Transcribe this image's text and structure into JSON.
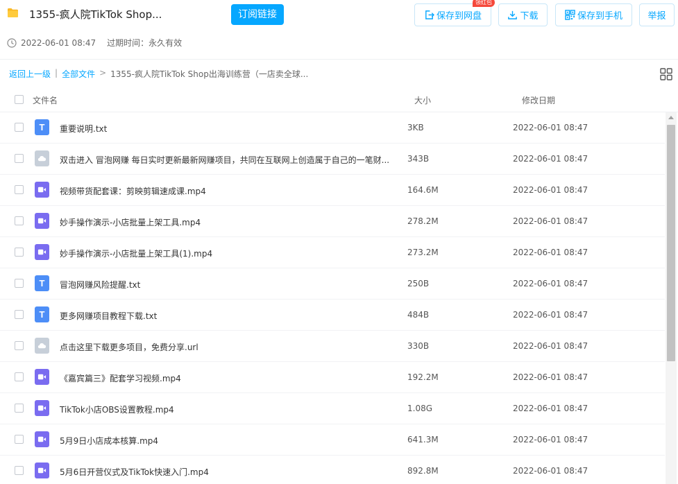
{
  "header": {
    "title": "1355-疯人院TikTok Shop...",
    "subscribe_label": "订阅链接",
    "save_label": "保存到网盘",
    "hongbao_label": "领红包",
    "download_label": "下载",
    "save_phone_label": "保存到手机",
    "report_label": "举报"
  },
  "meta": {
    "created": "2022-06-01 08:47",
    "expire": "过期时间：永久有效"
  },
  "breadcrumb": {
    "back": "返回上一级",
    "all_files": "全部文件",
    "sep": ">",
    "current": "1355-疯人院TikTok Shop出海训练营（一店卖全球..."
  },
  "columns": {
    "name": "文件名",
    "size": "大小",
    "date": "修改日期"
  },
  "files": [
    {
      "type": "txt",
      "name": "重要说明.txt",
      "size": "3KB",
      "date": "2022-06-01 08:47"
    },
    {
      "type": "url",
      "name": "双击进入 冒泡网赚 每日实时更新最新网赚项目，共同在互联网上创造属于自己的一笔财...",
      "size": "343B",
      "date": "2022-06-01 08:47"
    },
    {
      "type": "mp4",
      "name": "视频带货配套课：剪映剪辑速成课.mp4",
      "size": "164.6M",
      "date": "2022-06-01 08:47"
    },
    {
      "type": "mp4",
      "name": "妙手操作演示-小店批量上架工具.mp4",
      "size": "278.2M",
      "date": "2022-06-01 08:47"
    },
    {
      "type": "mp4",
      "name": "妙手操作演示-小店批量上架工具(1).mp4",
      "size": "273.2M",
      "date": "2022-06-01 08:47"
    },
    {
      "type": "txt",
      "name": "冒泡网赚风险提醒.txt",
      "size": "250B",
      "date": "2022-06-01 08:47"
    },
    {
      "type": "txt",
      "name": "更多网赚项目教程下载.txt",
      "size": "484B",
      "date": "2022-06-01 08:47"
    },
    {
      "type": "url",
      "name": "点击这里下载更多项目，免费分享.url",
      "size": "330B",
      "date": "2022-06-01 08:47"
    },
    {
      "type": "mp4",
      "name": "《嘉宾篇三》配套学习视频.mp4",
      "size": "192.2M",
      "date": "2022-06-01 08:47"
    },
    {
      "type": "mp4",
      "name": "TikTok小店OBS设置教程.mp4",
      "size": "1.08G",
      "date": "2022-06-01 08:47"
    },
    {
      "type": "mp4",
      "name": "5月9日小店成本核算.mp4",
      "size": "641.3M",
      "date": "2022-06-01 08:47"
    },
    {
      "type": "mp4",
      "name": "5月6日开营仪式及TikTok快速入门.mp4",
      "size": "892.8M",
      "date": "2022-06-01 08:47"
    }
  ],
  "icons": {
    "txt": "text-file-icon",
    "url": "link-file-icon",
    "mp4": "video-file-icon",
    "txt_glyph": "T"
  },
  "colors": {
    "accent": "#06a7ff",
    "txt_icon": "#4d8ef7",
    "video_icon": "#7a6cf0",
    "link_icon": "#c7cfd9",
    "hongbao": "#f5483b"
  }
}
